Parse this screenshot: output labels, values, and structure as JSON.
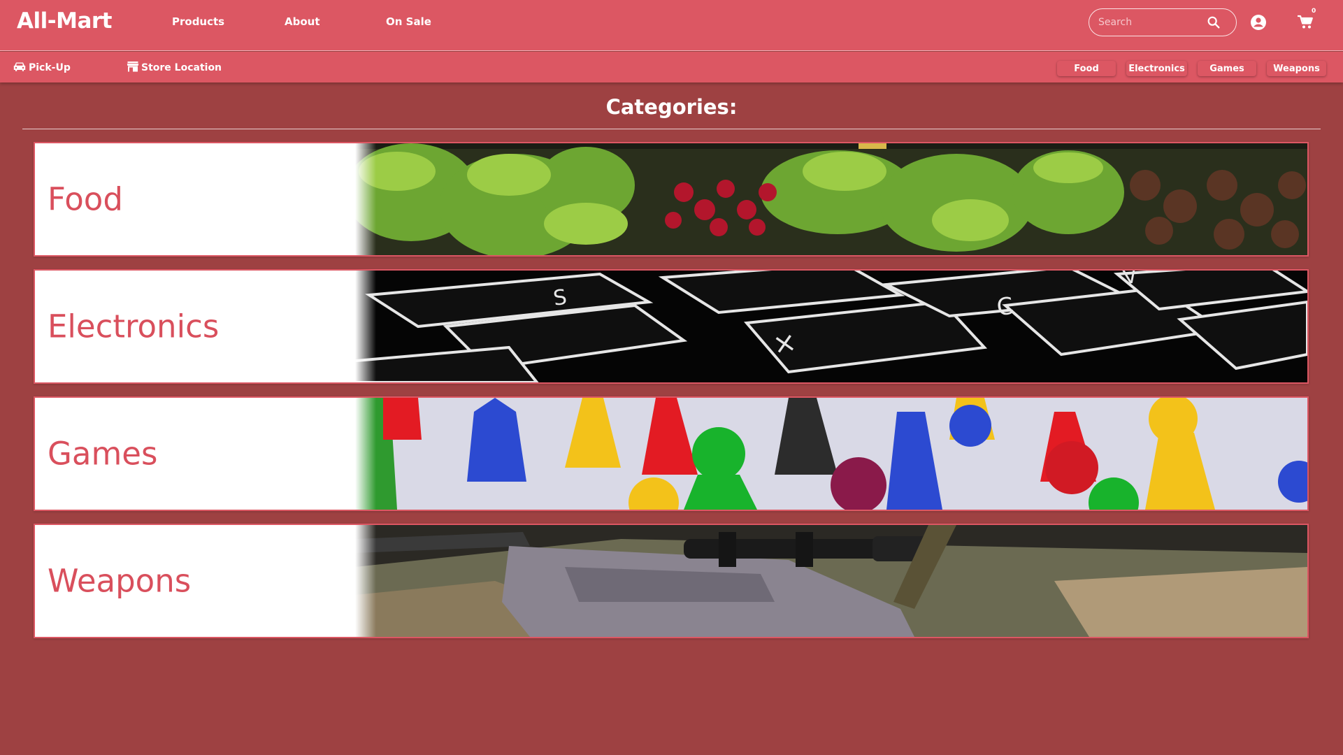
{
  "header": {
    "logo": "All-Mart",
    "nav": [
      "Products",
      "About",
      "On Sale"
    ],
    "search_placeholder": "Search",
    "cart_count": "0"
  },
  "subnav": {
    "pickup": "Pick-Up",
    "store_location": "Store Location",
    "chips": [
      "Food",
      "Electronics",
      "Games",
      "Weapons"
    ]
  },
  "main": {
    "heading": "Categories:",
    "categories": [
      {
        "label": "Food",
        "image": "vegetable-produce-shelf"
      },
      {
        "label": "Electronics",
        "image": "keyboard-keys-closeup"
      },
      {
        "label": "Games",
        "image": "board-game-pawns"
      },
      {
        "label": "Weapons",
        "image": "scoped-rifle"
      }
    ]
  },
  "colors": {
    "background": "#9e4142",
    "header": "#dc5763",
    "accent_text": "#d94f5c",
    "card": "#ffffff"
  }
}
